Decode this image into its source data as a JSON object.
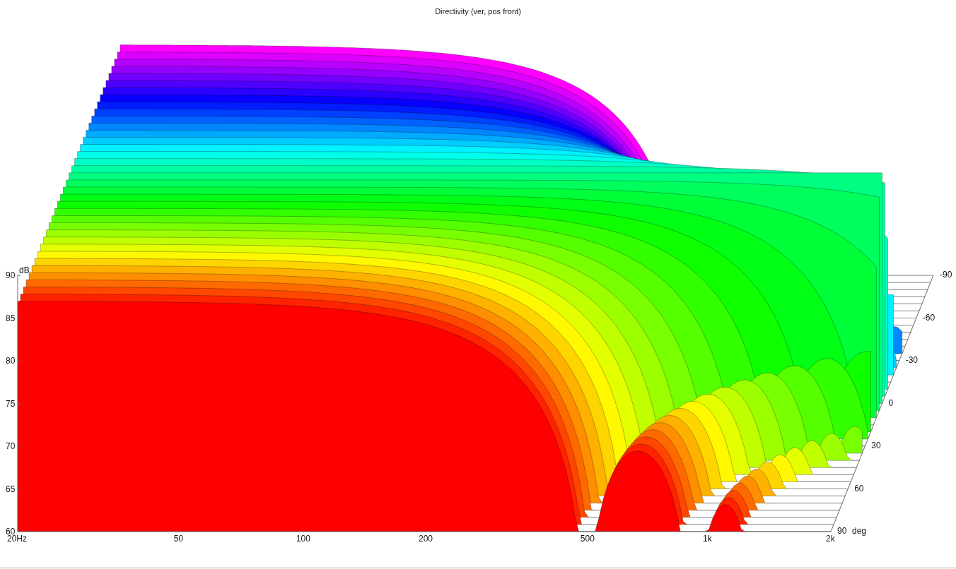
{
  "title": "Directivity (ver, pos front)",
  "level_axis": {
    "unit": "dB",
    "ticks": [
      "90",
      "85",
      "80",
      "75",
      "70",
      "65",
      "60"
    ]
  },
  "frequency_axis": {
    "ticks": [
      "20Hz",
      "50",
      "100",
      "200",
      "500",
      "1k",
      "2k"
    ]
  },
  "angle_axis": {
    "unit": "deg",
    "ticks": [
      "-90",
      "-60",
      "-30",
      "0",
      "30",
      "60",
      "90"
    ]
  }
}
